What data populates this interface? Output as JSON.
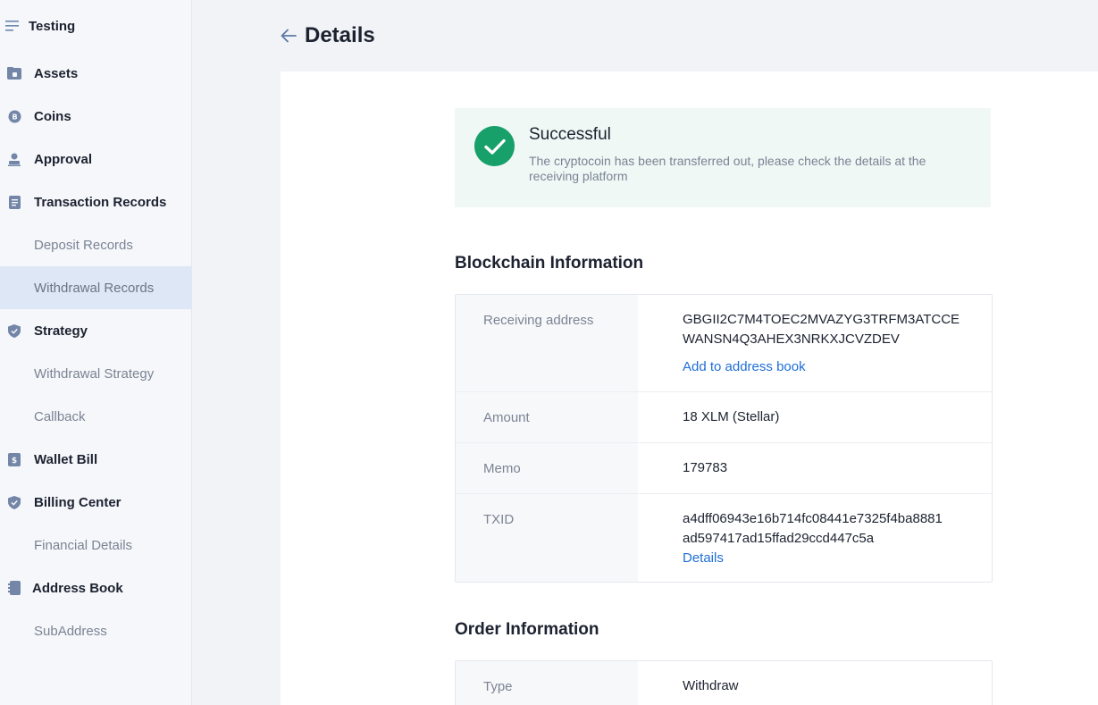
{
  "sidebar": {
    "brand": "Testing",
    "items": [
      {
        "label": "Assets",
        "icon": "wallet-icon",
        "type": "parent"
      },
      {
        "label": "Coins",
        "icon": "bitcoin-icon",
        "type": "parent"
      },
      {
        "label": "Approval",
        "icon": "user-stamp-icon",
        "type": "parent"
      },
      {
        "label": "Transaction Records",
        "icon": "document-icon",
        "type": "parent"
      },
      {
        "label": "Deposit Records",
        "type": "child"
      },
      {
        "label": "Withdrawal Records",
        "type": "child",
        "active": true
      },
      {
        "label": "Strategy",
        "icon": "shield-icon",
        "type": "parent"
      },
      {
        "label": "Withdrawal Strategy",
        "type": "child"
      },
      {
        "label": "Callback",
        "type": "child"
      },
      {
        "label": "Wallet Bill",
        "icon": "bill-icon",
        "type": "parent"
      },
      {
        "label": "Billing Center",
        "icon": "shield-icon",
        "type": "parent"
      },
      {
        "label": "Financial Details",
        "type": "child"
      },
      {
        "label": "Address Book",
        "icon": "address-book-icon",
        "type": "parent"
      },
      {
        "label": "SubAddress",
        "type": "child"
      }
    ]
  },
  "header": {
    "title": "Details"
  },
  "status": {
    "title": "Successful",
    "description": "The cryptocoin has been transferred out, please check the details at the receiving platform"
  },
  "blockchain": {
    "section_title": "Blockchain Information",
    "receiving_address_label": "Receiving address",
    "receiving_address_line1": "GBGII2C7M4TOEC2MVAZYG3TRFM3ATCCE",
    "receiving_address_line2": "WANSN4Q3AHEX3NRKXJCVZDEV",
    "add_to_address_book": "Add to address book",
    "amount_label": "Amount",
    "amount": "18 XLM (Stellar)",
    "memo_label": "Memo",
    "memo": "179783",
    "txid_label": "TXID",
    "txid_line1": "a4dff06943e16b714fc08441e7325f4ba8881",
    "txid_line2": "ad597417ad15ffad29ccd447c5a",
    "txid_details": "Details"
  },
  "order": {
    "section_title": "Order Information",
    "type_label": "Type",
    "type": "Withdraw"
  },
  "colors": {
    "success": "#18a06b",
    "link": "#1f6fd6",
    "sidebar_active": "#dde7f6"
  }
}
